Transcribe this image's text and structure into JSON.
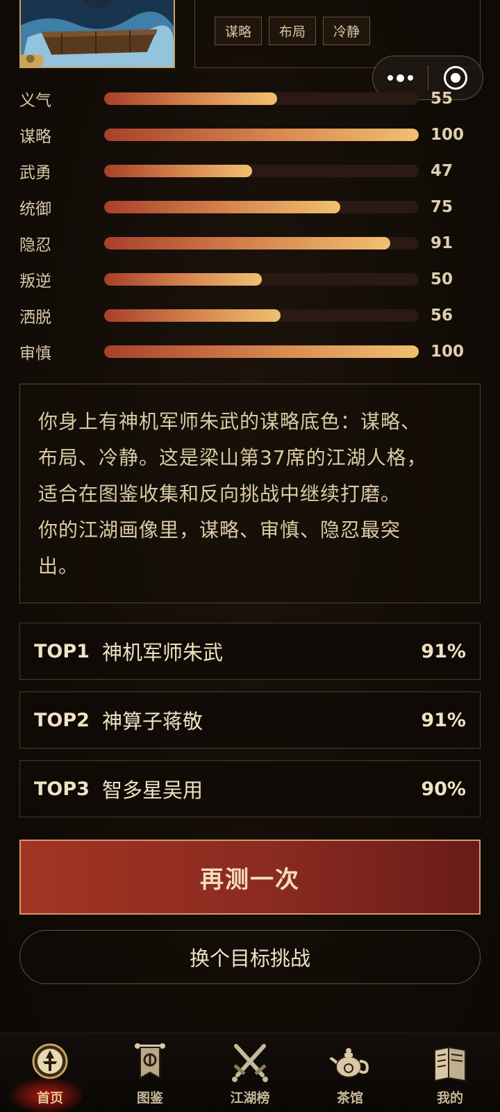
{
  "header": {
    "tags": [
      "谋略",
      "布局",
      "冷静"
    ]
  },
  "stats": [
    {
      "label": "义气",
      "value": 55
    },
    {
      "label": "谋略",
      "value": 100
    },
    {
      "label": "武勇",
      "value": 47
    },
    {
      "label": "统御",
      "value": 75
    },
    {
      "label": "隐忍",
      "value": 91
    },
    {
      "label": "叛逆",
      "value": 50
    },
    {
      "label": "洒脱",
      "value": 56
    },
    {
      "label": "审慎",
      "value": 100
    }
  ],
  "description": {
    "lines": [
      "你身上有神机军师朱武的谋略底色：谋略、",
      "布局、冷静。这是梁山第37席的江湖人格，",
      "适合在图鉴收集和反向挑战中继续打磨。",
      "你的江湖画像里，谋略、审慎、隐忍最突",
      "出。"
    ]
  },
  "top_matches": [
    {
      "rank": "TOP1",
      "name": "神机军师朱武",
      "percent": "91%"
    },
    {
      "rank": "TOP2",
      "name": "神算子蒋敬",
      "percent": "91%"
    },
    {
      "rank": "TOP3",
      "name": "智多星吴用",
      "percent": "90%"
    }
  ],
  "buttons": {
    "retest": "再测一次",
    "challenge": "换个目标挑战"
  },
  "tabbar": {
    "items": [
      {
        "label": "首页",
        "icon": "home-emblem-icon",
        "active": true
      },
      {
        "label": "图鉴",
        "icon": "banner-icon",
        "active": false
      },
      {
        "label": "江湖榜",
        "icon": "crossed-swords-icon",
        "active": false
      },
      {
        "label": "茶馆",
        "icon": "teapot-icon",
        "active": false
      },
      {
        "label": "我的",
        "icon": "scroll-book-icon",
        "active": false
      }
    ]
  },
  "colors": {
    "accent_red": "#a33424",
    "gold": "#c9a45a",
    "bar_start": "#a8402a",
    "bar_end": "#f0c070"
  }
}
